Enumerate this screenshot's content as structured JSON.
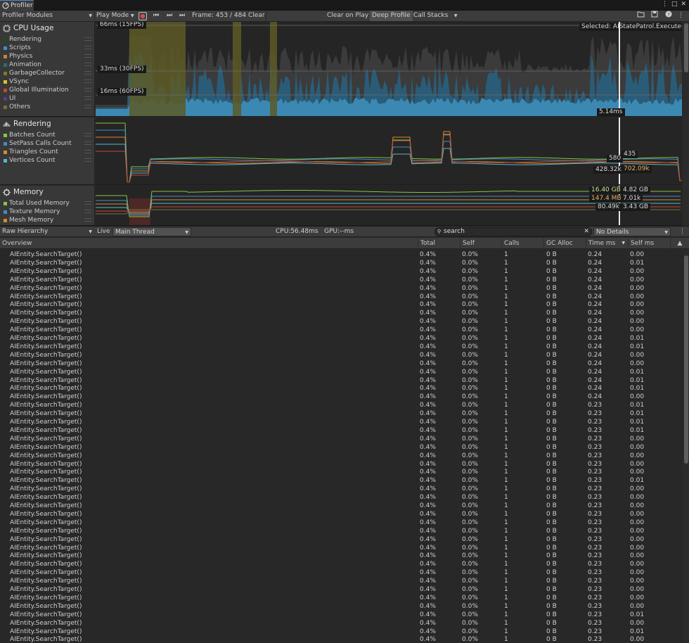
{
  "window": {
    "tab_label": "Profiler",
    "controls": [
      "⋮",
      "□",
      "✕"
    ]
  },
  "toolbar": {
    "modules_label": "Profiler Modules",
    "play_mode_label": "Play Mode",
    "frame_label": "Frame: 453 / 484",
    "clear_label": "Clear",
    "clear_on_play_label": "Clear on Play",
    "deep_profile_label": "Deep Profile",
    "call_stacks_label": "Call Stacks"
  },
  "cpu": {
    "title": "CPU Usage",
    "legend": [
      {
        "label": "Rendering",
        "color": "#1e4d16"
      },
      {
        "label": "Scripts",
        "color": "#3d8fc6"
      },
      {
        "label": "Physics",
        "color": "#c7823b"
      },
      {
        "label": "Animation",
        "color": "#2d6d6d"
      },
      {
        "label": "GarbageCollector",
        "color": "#7f7a25"
      },
      {
        "label": "VSync",
        "color": "#d7c12c"
      },
      {
        "label": "Global Illumination",
        "color": "#c04637"
      },
      {
        "label": "UI",
        "color": "#5a3d8a"
      },
      {
        "label": "Others",
        "color": "#7a6f3b"
      }
    ],
    "fps_labels": [
      "66ms (15FPS)",
      "33ms (30FPS)",
      "16ms (60FPS)"
    ],
    "selected_label": "Selected: AIStatePatrol.Execute()",
    "cursor_label": "5.14ms"
  },
  "rendering": {
    "title": "Rendering",
    "legend": [
      {
        "label": "Batches Count",
        "color": "#8cc43f"
      },
      {
        "label": "SetPass Calls Count",
        "color": "#3d8fc6"
      },
      {
        "label": "Triangles Count",
        "color": "#d98a2c"
      },
      {
        "label": "Vertices Count",
        "color": "#59b7c9"
      }
    ],
    "values": [
      "580",
      "435",
      "428.32k",
      "702.09k"
    ]
  },
  "memory": {
    "title": "Memory",
    "legend": [
      {
        "label": "Total Used Memory",
        "color": "#8cc43f"
      },
      {
        "label": "Texture Memory",
        "color": "#3d8fc6"
      },
      {
        "label": "Mesh Memory",
        "color": "#d98a2c"
      }
    ],
    "values": [
      "16.40 GB",
      "4.82 GB",
      "147.4 MB",
      "7.01k",
      "80.49k",
      "3.43 GB"
    ]
  },
  "detail_toolbar": {
    "view_label": "Raw Hierarchy",
    "live_label": "Live",
    "thread_label": "Main Thread",
    "cpu_gpu_label": "CPU:56.48ms   GPU:--ms",
    "search_value": "search",
    "details_label": "No Details"
  },
  "table": {
    "columns": [
      "Overview",
      "Total",
      "Self",
      "Calls",
      "GC Alloc",
      "Time ms",
      "Self ms"
    ],
    "rows": [
      [
        "AIEntity.SearchTarget()",
        "0.4%",
        "0.0%",
        "1",
        "0 B",
        "0.24",
        "0.00"
      ],
      [
        "AIEntity.SearchTarget()",
        "0.4%",
        "0.0%",
        "1",
        "0 B",
        "0.24",
        "0.01"
      ],
      [
        "AIEntity.SearchTarget()",
        "0.4%",
        "0.0%",
        "1",
        "0 B",
        "0.24",
        "0.00"
      ],
      [
        "AIEntity.SearchTarget()",
        "0.4%",
        "0.0%",
        "1",
        "0 B",
        "0.24",
        "0.00"
      ],
      [
        "AIEntity.SearchTarget()",
        "0.4%",
        "0.0%",
        "1",
        "0 B",
        "0.24",
        "0.00"
      ],
      [
        "AIEntity.SearchTarget()",
        "0.4%",
        "0.0%",
        "1",
        "0 B",
        "0.24",
        "0.00"
      ],
      [
        "AIEntity.SearchTarget()",
        "0.4%",
        "0.0%",
        "1",
        "0 B",
        "0.24",
        "0.00"
      ],
      [
        "AIEntity.SearchTarget()",
        "0.4%",
        "0.0%",
        "1",
        "0 B",
        "0.24",
        "0.00"
      ],
      [
        "AIEntity.SearchTarget()",
        "0.4%",
        "0.0%",
        "1",
        "0 B",
        "0.24",
        "0.00"
      ],
      [
        "AIEntity.SearchTarget()",
        "0.4%",
        "0.0%",
        "1",
        "0 B",
        "0.24",
        "0.00"
      ],
      [
        "AIEntity.SearchTarget()",
        "0.4%",
        "0.0%",
        "1",
        "0 B",
        "0.24",
        "0.01"
      ],
      [
        "AIEntity.SearchTarget()",
        "0.4%",
        "0.0%",
        "1",
        "0 B",
        "0.24",
        "0.01"
      ],
      [
        "AIEntity.SearchTarget()",
        "0.4%",
        "0.0%",
        "1",
        "0 B",
        "0.24",
        "0.00"
      ],
      [
        "AIEntity.SearchTarget()",
        "0.4%",
        "0.0%",
        "1",
        "0 B",
        "0.24",
        "0.00"
      ],
      [
        "AIEntity.SearchTarget()",
        "0.4%",
        "0.0%",
        "1",
        "0 B",
        "0.24",
        "0.01"
      ],
      [
        "AIEntity.SearchTarget()",
        "0.4%",
        "0.0%",
        "1",
        "0 B",
        "0.24",
        "0.01"
      ],
      [
        "AIEntity.SearchTarget()",
        "0.4%",
        "0.0%",
        "1",
        "0 B",
        "0.24",
        "0.01"
      ],
      [
        "AIEntity.SearchTarget()",
        "0.4%",
        "0.0%",
        "1",
        "0 B",
        "0.24",
        "0.00"
      ],
      [
        "AIEntity.SearchTarget()",
        "0.4%",
        "0.0%",
        "1",
        "0 B",
        "0.23",
        "0.01"
      ],
      [
        "AIEntity.SearchTarget()",
        "0.4%",
        "0.0%",
        "1",
        "0 B",
        "0.23",
        "0.01"
      ],
      [
        "AIEntity.SearchTarget()",
        "0.4%",
        "0.0%",
        "1",
        "0 B",
        "0.23",
        "0.01"
      ],
      [
        "AIEntity.SearchTarget()",
        "0.4%",
        "0.0%",
        "1",
        "0 B",
        "0.23",
        "0.01"
      ],
      [
        "AIEntity.SearchTarget()",
        "0.4%",
        "0.0%",
        "1",
        "0 B",
        "0.23",
        "0.00"
      ],
      [
        "AIEntity.SearchTarget()",
        "0.4%",
        "0.0%",
        "1",
        "0 B",
        "0.23",
        "0.00"
      ],
      [
        "AIEntity.SearchTarget()",
        "0.4%",
        "0.0%",
        "1",
        "0 B",
        "0.23",
        "0.00"
      ],
      [
        "AIEntity.SearchTarget()",
        "0.4%",
        "0.0%",
        "1",
        "0 B",
        "0.23",
        "0.00"
      ],
      [
        "AIEntity.SearchTarget()",
        "0.4%",
        "0.0%",
        "1",
        "0 B",
        "0.23",
        "0.00"
      ],
      [
        "AIEntity.SearchTarget()",
        "0.4%",
        "0.0%",
        "1",
        "0 B",
        "0.23",
        "0.01"
      ],
      [
        "AIEntity.SearchTarget()",
        "0.4%",
        "0.0%",
        "1",
        "0 B",
        "0.23",
        "0.00"
      ],
      [
        "AIEntity.SearchTarget()",
        "0.4%",
        "0.0%",
        "1",
        "0 B",
        "0.23",
        "0.00"
      ],
      [
        "AIEntity.SearchTarget()",
        "0.4%",
        "0.0%",
        "1",
        "0 B",
        "0.23",
        "0.00"
      ],
      [
        "AIEntity.SearchTarget()",
        "0.4%",
        "0.0%",
        "1",
        "0 B",
        "0.23",
        "0.00"
      ],
      [
        "AIEntity.SearchTarget()",
        "0.4%",
        "0.0%",
        "1",
        "0 B",
        "0.23",
        "0.00"
      ],
      [
        "AIEntity.SearchTarget()",
        "0.4%",
        "0.0%",
        "1",
        "0 B",
        "0.23",
        "0.00"
      ],
      [
        "AIEntity.SearchTarget()",
        "0.4%",
        "0.0%",
        "1",
        "0 B",
        "0.23",
        "0.00"
      ],
      [
        "AIEntity.SearchTarget()",
        "0.4%",
        "0.0%",
        "1",
        "0 B",
        "0.23",
        "0.00"
      ],
      [
        "AIEntity.SearchTarget()",
        "0.4%",
        "0.0%",
        "1",
        "0 B",
        "0.23",
        "0.00"
      ],
      [
        "AIEntity.SearchTarget()",
        "0.4%",
        "0.0%",
        "1",
        "0 B",
        "0.23",
        "0.00"
      ],
      [
        "AIEntity.SearchTarget()",
        "0.4%",
        "0.0%",
        "1",
        "0 B",
        "0.23",
        "0.00"
      ],
      [
        "AIEntity.SearchTarget()",
        "0.4%",
        "0.0%",
        "1",
        "0 B",
        "0.23",
        "0.00"
      ],
      [
        "AIEntity.SearchTarget()",
        "0.4%",
        "0.0%",
        "1",
        "0 B",
        "0.23",
        "0.00"
      ],
      [
        "AIEntity.SearchTarget()",
        "0.4%",
        "0.0%",
        "1",
        "0 B",
        "0.23",
        "0.00"
      ],
      [
        "AIEntity.SearchTarget()",
        "0.4%",
        "0.0%",
        "1",
        "0 B",
        "0.23",
        "0.00"
      ],
      [
        "AIEntity.SearchTarget()",
        "0.4%",
        "0.0%",
        "1",
        "0 B",
        "0.23",
        "0.01"
      ],
      [
        "AIEntity.SearchTarget()",
        "0.4%",
        "0.0%",
        "1",
        "0 B",
        "0.23",
        "0.00"
      ],
      [
        "AIEntity.SearchTarget()",
        "0.4%",
        "0.0%",
        "1",
        "0 B",
        "0.23",
        "0.01"
      ],
      [
        "AIEntity.SearchTarget()",
        "0.4%",
        "0.0%",
        "1",
        "0 B",
        "0.23",
        "0.00"
      ]
    ]
  }
}
